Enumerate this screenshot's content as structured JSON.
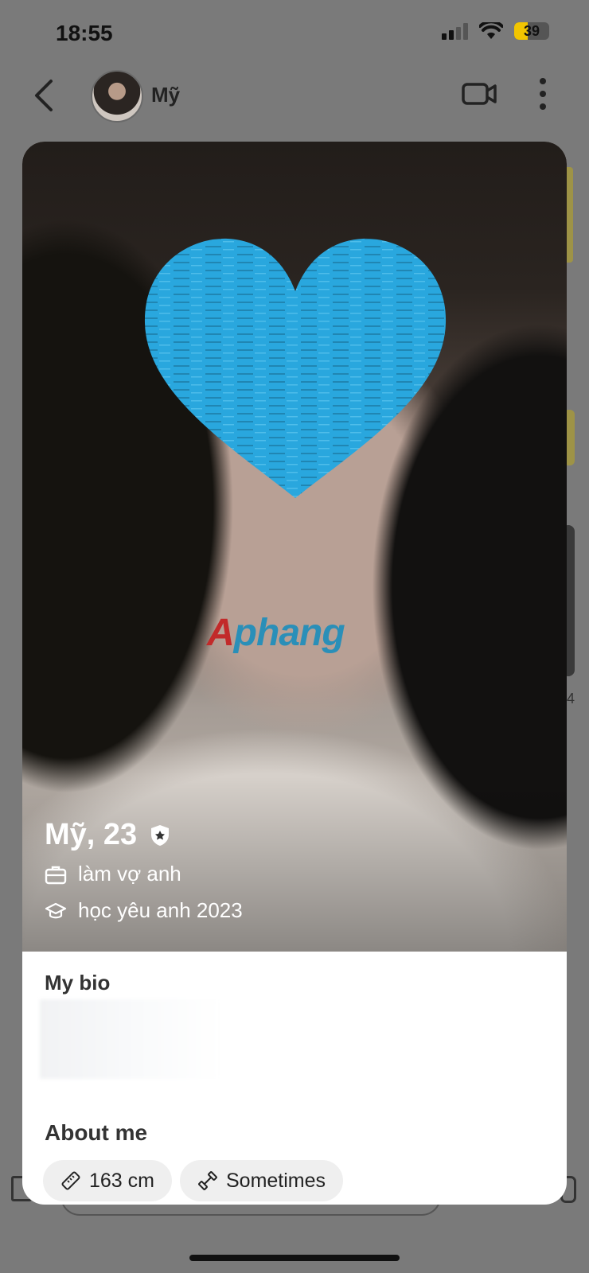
{
  "status_bar": {
    "time": "18:55",
    "battery": "39",
    "battery_fraction": 0.39
  },
  "header": {
    "name": "Mỹ"
  },
  "profile": {
    "name_age": "Mỹ, 23",
    "job": "làm vợ anh",
    "education": "học yêu anh 2023"
  },
  "watermark": {
    "first": "A",
    "rest": "phang"
  },
  "bio": {
    "title": "My bio"
  },
  "about": {
    "title": "About me",
    "chips": [
      {
        "icon": "ruler-icon",
        "label": "163 cm"
      },
      {
        "icon": "dumbbell-icon",
        "label": "Sometimes"
      }
    ]
  },
  "peek": {
    "number": "4"
  },
  "colors": {
    "heart": "#29a7de",
    "accent": "#f2c500"
  }
}
